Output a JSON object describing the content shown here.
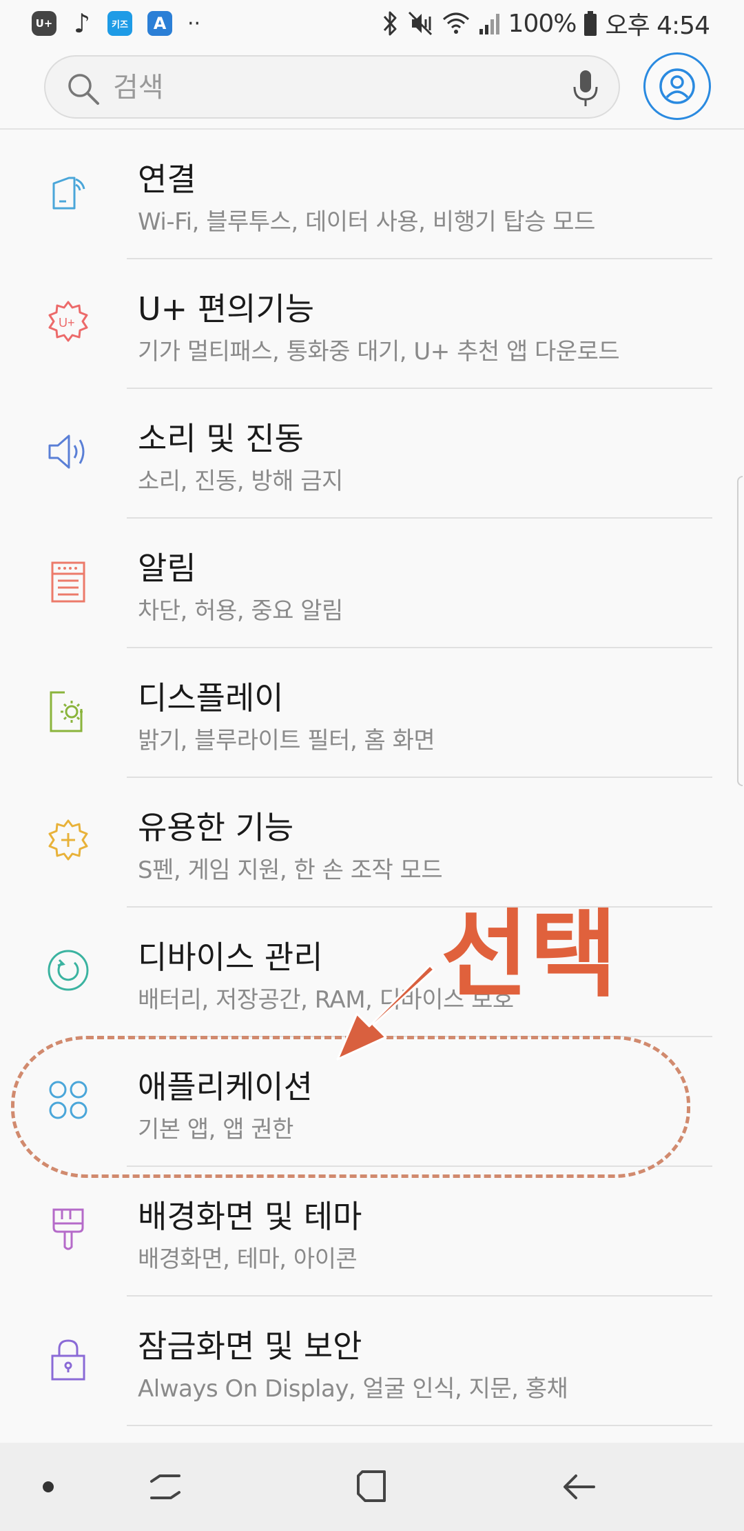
{
  "status_bar": {
    "app_badges": [
      "U+",
      "♪",
      "키즈",
      "A",
      "··"
    ],
    "battery": "100%",
    "time": "오후 4:54"
  },
  "search": {
    "placeholder": "검색"
  },
  "settings": [
    {
      "title": "연결",
      "subtitle": "Wi-Fi, 블루투스, 데이터 사용, 비행기 탑승 모드",
      "icon": "connection-icon",
      "color": "#4aa6d9"
    },
    {
      "title": "U+ 편의기능",
      "subtitle": "기가 멀티패스, 통화중 대기, U+ 추천 앱 다운로드",
      "icon": "uplus-gear-icon",
      "color": "#ec6a6a"
    },
    {
      "title": "소리 및 진동",
      "subtitle": "소리, 진동, 방해 금지",
      "icon": "speaker-icon",
      "color": "#5a7fd6"
    },
    {
      "title": "알림",
      "subtitle": "차단, 허용, 중요 알림",
      "icon": "notification-icon",
      "color": "#ec7a6a"
    },
    {
      "title": "디스플레이",
      "subtitle": "밝기, 블루라이트 필터, 홈 화면",
      "icon": "display-icon",
      "color": "#8ab43c"
    },
    {
      "title": "유용한 기능",
      "subtitle": "S펜, 게임 지원, 한 손 조작 모드",
      "icon": "advanced-features-icon",
      "color": "#e8b23a"
    },
    {
      "title": "디바이스 관리",
      "subtitle": "배터리, 저장공간, RAM, 디바이스 보호",
      "icon": "device-care-icon",
      "color": "#3bb3a0"
    },
    {
      "title": "애플리케이션",
      "subtitle": "기본 앱, 앱 권한",
      "icon": "apps-icon",
      "color": "#4aa6d9"
    },
    {
      "title": "배경화면 및 테마",
      "subtitle": "배경화면, 테마, 아이콘",
      "icon": "wallpaper-brush-icon",
      "color": "#b56ac9"
    },
    {
      "title": "잠금화면 및 보안",
      "subtitle": "Always On Display, 얼굴 인식, 지문, 홍채",
      "icon": "lock-icon",
      "color": "#8a6ad6"
    }
  ],
  "annotation": {
    "label": "선택",
    "color": "#e0613c"
  },
  "nav_bar": {
    "buttons": [
      "recents-icon",
      "home-icon",
      "back-icon"
    ]
  }
}
